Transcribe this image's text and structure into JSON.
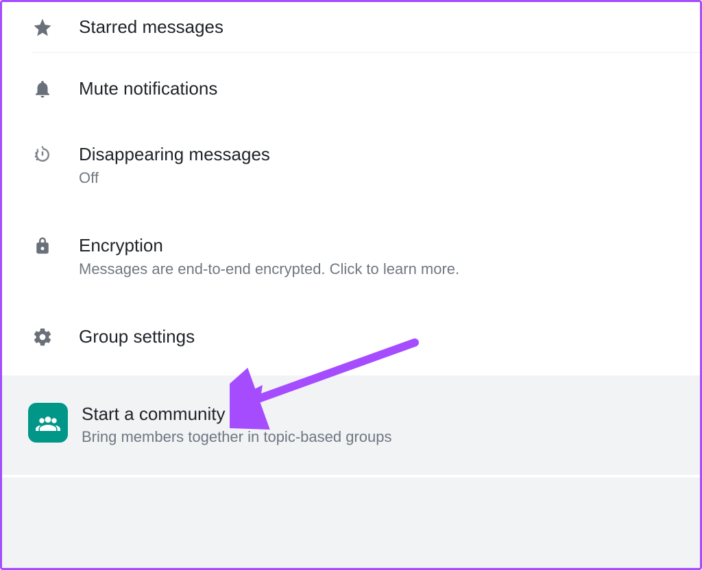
{
  "menu": {
    "starred": {
      "label": "Starred messages"
    },
    "mute": {
      "label": "Mute notifications"
    },
    "disappearing": {
      "label": "Disappearing messages",
      "status": "Off"
    },
    "encryption": {
      "label": "Encryption",
      "desc": "Messages are end-to-end encrypted. Click to learn more."
    },
    "group": {
      "label": "Group settings"
    }
  },
  "community": {
    "title": "Start a community",
    "subtitle": "Bring members together in topic-based groups"
  },
  "annotation": {
    "arrow_color": "#a64cff"
  }
}
